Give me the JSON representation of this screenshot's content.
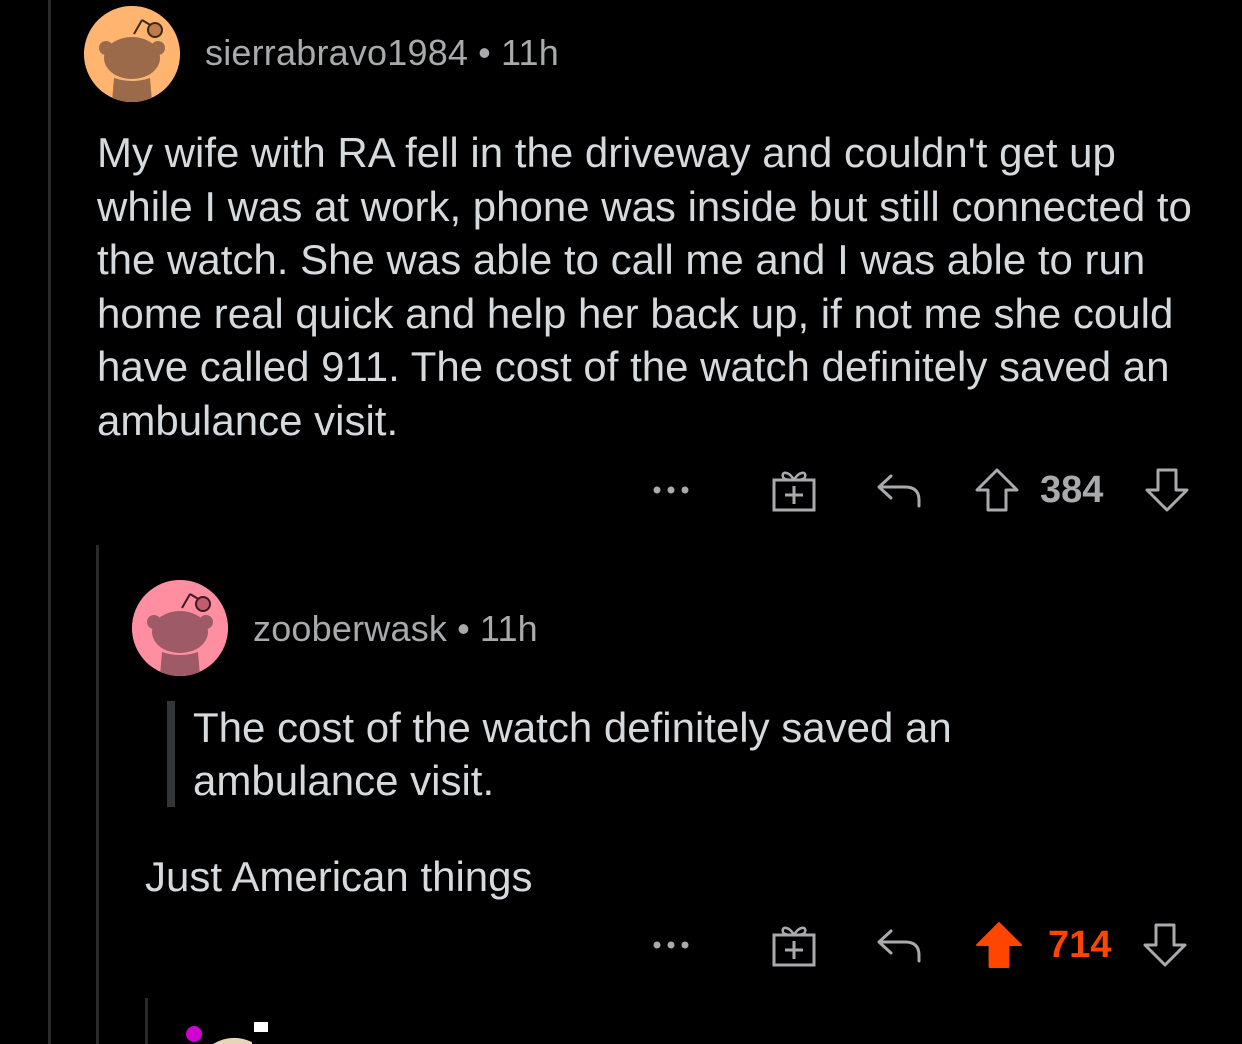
{
  "comments": [
    {
      "username": "sierrabravo1984",
      "separator": "•",
      "age": "11h",
      "body": "My wife with RA fell in the driveway and couldn't get up while I was at work, phone was inside but still connected to the watch.  She was able to call me and I was able to run home real quick and help her back up, if not me she could have called 911.  The cost of the watch definitely saved an ambulance visit.",
      "score": "384",
      "upvoted": false,
      "avatar_color": "#ffb470"
    },
    {
      "username": "zooberwask",
      "separator": "•",
      "age": "11h",
      "quote": "The cost of the watch definitely saved an ambulance visit.",
      "body": "Just American things",
      "score": "714",
      "upvoted": true,
      "avatar_color": "#ff8ea0"
    }
  ],
  "icons": {
    "more": "more-options-icon",
    "award": "gift-award-icon",
    "reply": "reply-arrow-icon",
    "upvote": "upvote-arrow-icon",
    "downvote": "downvote-arrow-icon"
  },
  "colors": {
    "background": "#000000",
    "text": "#d7dadc",
    "meta": "#a8aaab",
    "upvote_accent": "#ff4500"
  }
}
